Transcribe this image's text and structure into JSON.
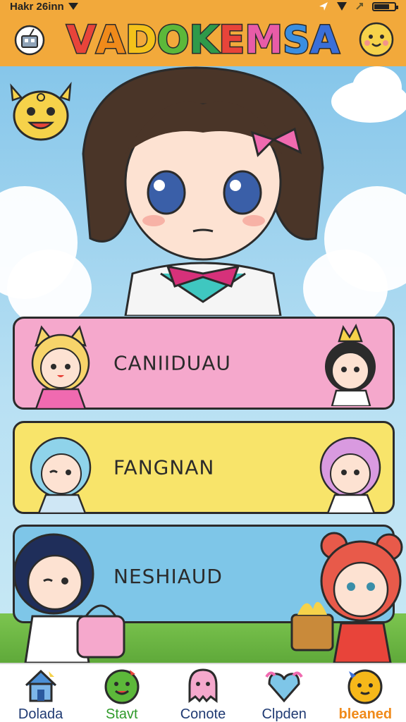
{
  "status_bar": {
    "time_text": "Hakr 26inn",
    "battery_level": 0.75
  },
  "header": {
    "title_letters": [
      {
        "ch": "V",
        "color": "#e8443a"
      },
      {
        "ch": "A",
        "color": "#f08a1a"
      },
      {
        "ch": "D",
        "color": "#f4c21a"
      },
      {
        "ch": "O",
        "color": "#5cb83a"
      },
      {
        "ch": "K",
        "color": "#2f9a4a"
      },
      {
        "ch": "E",
        "color": "#e8443a"
      },
      {
        "ch": "M",
        "color": "#e85ca8"
      },
      {
        "ch": "S",
        "color": "#3a8ee0"
      },
      {
        "ch": "A",
        "color": "#3a6fd8"
      }
    ],
    "left_icon": "box-robot-icon",
    "right_icon": "smiley-face-icon"
  },
  "categories": [
    {
      "label": "CANIIDUAU",
      "color": "#f5a8cc"
    },
    {
      "label": "FANGNAN",
      "color": "#f8e46a"
    },
    {
      "label": "NESHIAUD",
      "color": "#7ec6e8"
    }
  ],
  "bottom_nav": [
    {
      "label": "Dolada",
      "icon": "house-icon"
    },
    {
      "label": "Stavt",
      "icon": "green-blob-icon"
    },
    {
      "label": "Conote",
      "icon": "pink-ghost-icon"
    },
    {
      "label": "Clpden",
      "icon": "heart-gem-icon"
    },
    {
      "label": "bleaned",
      "icon": "orange-face-icon"
    }
  ],
  "colors": {
    "header": "#f2a93b",
    "sky": "#9fd3ef",
    "outline": "#2b2b2b"
  }
}
